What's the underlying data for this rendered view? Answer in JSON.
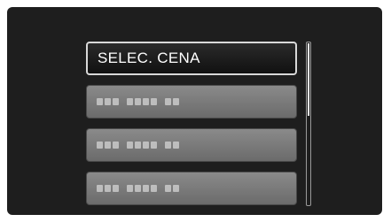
{
  "menu": {
    "items": [
      {
        "label": "SELEC. CENA",
        "selected": true
      },
      {
        "label": "",
        "selected": false,
        "obscured": true
      },
      {
        "label": "",
        "selected": false,
        "obscured": true
      },
      {
        "label": "",
        "selected": false,
        "obscured": true
      }
    ]
  },
  "scrollbar": {
    "position_fraction": 0.0
  },
  "colors": {
    "screen_bg": "#1e1e1e",
    "item_bg": "#7a7a7a",
    "selected_border": "#d8d8d8",
    "text": "#ffffff"
  }
}
